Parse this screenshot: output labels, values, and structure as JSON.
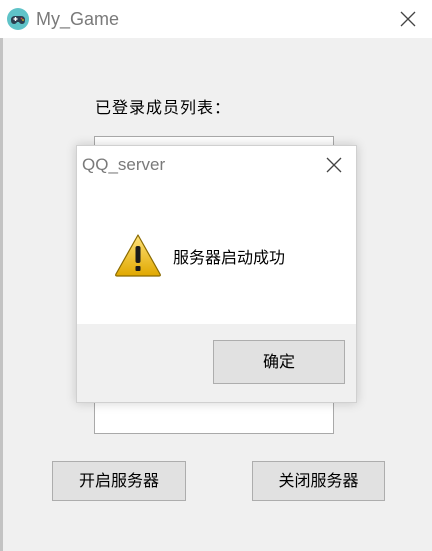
{
  "main_window": {
    "title": "My_Game",
    "members_label": "已登录成员列表：",
    "start_button_label": "开启服务器",
    "stop_button_label": "关闭服务器"
  },
  "dialog": {
    "title": "QQ_server",
    "message": "服务器启动成功",
    "ok_button_label": "确定",
    "icon": "warning-icon"
  },
  "colors": {
    "title_text": "#7a7a7a",
    "button_bg": "#e1e1e1",
    "button_border": "#adadad",
    "warning_fill": "#f2c21b"
  }
}
